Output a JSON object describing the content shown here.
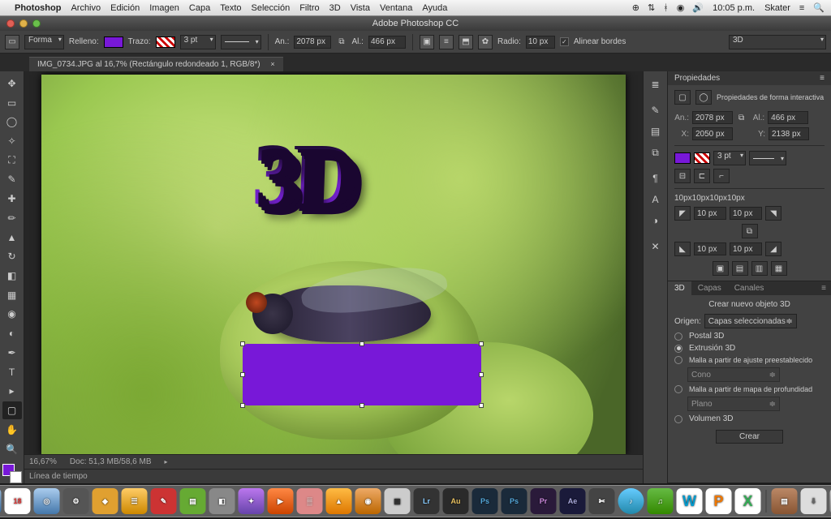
{
  "menubar": {
    "app": "Photoshop",
    "items": [
      "Archivo",
      "Edición",
      "Imagen",
      "Capa",
      "Texto",
      "Selección",
      "Filtro",
      "3D",
      "Vista",
      "Ventana",
      "Ayuda"
    ],
    "clock": "10:05 p.m.",
    "user": "Skater"
  },
  "titlebar": {
    "title": "Adobe Photoshop CC"
  },
  "options": {
    "mode": "Forma",
    "fill_label": "Relleno:",
    "fill_color": "#7818d8",
    "stroke_label": "Trazo:",
    "stroke_width": "3 pt",
    "w_label": "An.:",
    "w_value": "2078 px",
    "h_label": "Al.:",
    "h_value": "466 px",
    "radius_label": "Radio:",
    "radius_value": "10 px",
    "align_label": "Alinear bordes",
    "workspace": "3D"
  },
  "doc_tab": {
    "title": "IMG_0734.JPG al 16,7% (Rectángulo redondeado 1, RGB/8*)"
  },
  "canvas": {
    "text3d": "3D",
    "rect_color": "#7818d8"
  },
  "status": {
    "zoom": "16,67%",
    "doc_info": "Doc: 51,3 MB/58,6 MB",
    "timeline": "Línea de tiempo"
  },
  "properties": {
    "panel_title": "Propiedades",
    "subtitle": "Propiedades de forma interactiva",
    "w_label": "An.:",
    "w": "2078 px",
    "h_label": "Al.:",
    "h": "466 px",
    "x_label": "X:",
    "x": "2050 px",
    "y_label": "Y:",
    "y": "2138 px",
    "stroke_width": "3 pt",
    "corners_summary": "10px10px10px10px",
    "corner": "10 px"
  },
  "panel3d": {
    "tabs": [
      "3D",
      "Capas",
      "Canales"
    ],
    "heading": "Crear nuevo objeto 3D",
    "origin_label": "Origen:",
    "origin_value": "Capas seleccionadas",
    "opt_postal": "Postal 3D",
    "opt_extrusion": "Extrusión 3D",
    "opt_mesh": "Malla a partir de ajuste preestablecido",
    "mesh_preset": "Cono",
    "opt_depth": "Malla a partir de mapa de profundidad",
    "depth_preset": "Plano",
    "opt_volume": "Volumen 3D",
    "create": "Crear"
  },
  "fg_color": "#7818d8"
}
